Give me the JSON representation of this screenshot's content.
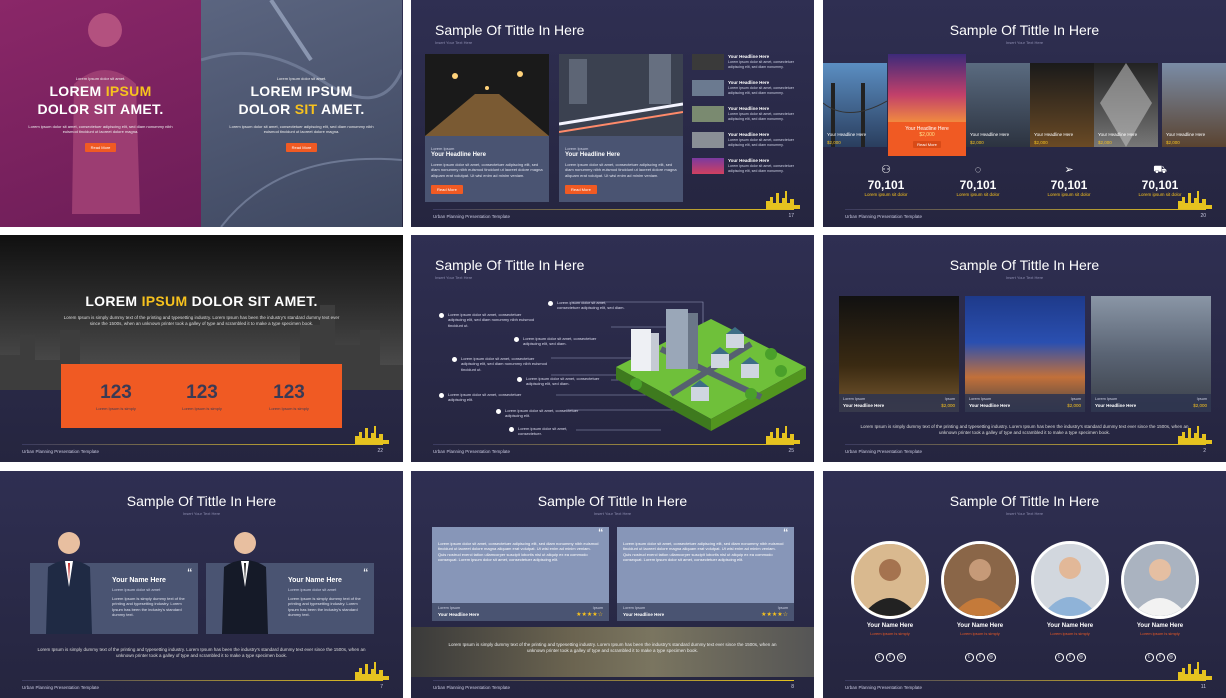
{
  "colors": {
    "accent": "#f05a23",
    "highlight": "#f7c21e",
    "slide_bg": "#2a2a48",
    "card": "#4a5472"
  },
  "common": {
    "footer": "Urban Planning Presentation Template",
    "title": "Sample Of Tittle In Here",
    "subtitle": "Insert Your Text Here",
    "read_more": "Read More",
    "lorem_short": "Lorem ipsum dolor sit amet, consectetuer adipiscing elit, sed diam nonummy nibh euismod tincidunt ut laoreet dolore magna aliquam erat volutpat. Ut wisi enim ad minim veniam.",
    "lorem_long": "Lorem Ipsum is simply dummy text of the printing and typesetting industry. Lorem Ipsum has been the industry's standard dummy text ever since the 1500s, when an unknown printer took a galley of type and scrambled it to make a type specimen book."
  },
  "slide1": {
    "left": {
      "kicker": "Lorem Ipsum dolor sit amet.",
      "line1_a": "LOREM ",
      "line1_b": "IPSUM",
      "line2": "DOLOR SIT AMET.",
      "body": "Lorem ipsum dolor sit amet, consectetuer adipiscing elit, sed diam nonummy nibh euismod tincidunt ut laoreet dolore magna."
    },
    "right": {
      "kicker": "Lorem Ipsum dolor sit amet.",
      "line1": "LOREM IPSUM",
      "line2_a": "DOLOR ",
      "line2_b": "SIT",
      "line2_c": " AMET.",
      "body": "Lorem ipsum dolor sit amet, consectetuer adipiscing elit, sed diam nonummy nibh euismod tincidunt ut laoreet dolore magna."
    }
  },
  "slide2": {
    "page": "17",
    "cards": [
      {
        "label": "Lorem Ipsum",
        "head": "Your Headline Here",
        "body": "Lorem ipsum dolor sit amet, consectetuer adipiscing elit, sed diam nonummy nibh euismod tincidunt ut laoreet dolore magna aliquam erat volutpat. Ut wisi enim ad minim veniam."
      },
      {
        "label": "Lorem Ipsum",
        "head": "Your Headline Here",
        "body": "Lorem ipsum dolor sit amet, consectetuer adipiscing elit, sed diam nonummy nibh euismod tincidunt ut laoreet dolore magna aliquam erat volutpat. Ut wisi enim ad minim veniam."
      }
    ],
    "list": [
      {
        "head": "Your Headline Here",
        "text": "Lorem ipsum dolor sit amet, consectetuer adipiscing elit, sed diam nonummy."
      },
      {
        "head": "Your Headline Here",
        "text": "Lorem ipsum dolor sit amet, consectetuer adipiscing elit, sed diam nonummy."
      },
      {
        "head": "Your Headline Here",
        "text": "Lorem ipsum dolor sit amet, consectetuer adipiscing elit, sed diam nonummy."
      },
      {
        "head": "Your Headline Here",
        "text": "Lorem ipsum dolor sit amet, consectetuer adipiscing elit, sed diam nonummy."
      },
      {
        "head": "Your Headline Here",
        "text": "Lorem ipsum dolor sit amet, consectetuer adipiscing elit, sed diam nonummy."
      }
    ]
  },
  "slide3": {
    "page": "20",
    "cells": [
      {
        "head": "Your Headline Here",
        "price": "$2,000"
      },
      {
        "head": "Your Headline Here",
        "price": "$2,000"
      },
      {
        "head": "Your Headline Here",
        "price": "$2,000"
      },
      {
        "head": "Your Headline Here",
        "price": "$2,000"
      },
      {
        "head": "Your Headline Here",
        "price": "$2,000"
      },
      {
        "head": "Your Headline Here",
        "price": "$2,000"
      }
    ],
    "stats": [
      {
        "icon": "user-icon",
        "num": "70,101",
        "label": "Lorem ipsum sit dolor"
      },
      {
        "icon": "chat-icon",
        "num": "70,101",
        "label": "Lorem ipsum sit dolor"
      },
      {
        "icon": "send-icon",
        "num": "70,101",
        "label": "Lorem ipsum sit dolor"
      },
      {
        "icon": "truck-icon",
        "num": "70,101",
        "label": "Lorem ipsum sit dolor"
      }
    ]
  },
  "slide4": {
    "page": "22",
    "t_a": "LOREM ",
    "t_b": "IPSUM",
    "t_c": " DOLOR SIT AMET.",
    "body": "Lorem Ipsum is simply dummy text of the printing and typesetting industry. Lorem Ipsum has been the industry's standard dummy text ever since the 1500s, when an unknown printer took a galley of type and scrambled it to make a type specimen book.",
    "counters": [
      {
        "num": "123",
        "label": "Lorem Ipsum is simply"
      },
      {
        "num": "123",
        "label": "Lorem Ipsum is simply"
      },
      {
        "num": "123",
        "label": "Lorem Ipsum is simply"
      }
    ]
  },
  "slide5": {
    "page": "25",
    "bullets": [
      "Lorem ipsum dolor sit amet, consectetuer adipiscing elit, sed diam.",
      "Lorem ipsum dolor sit amet, consectetuer adipiscing elit, sed diam nonummy nibh euismod tincidunt ut.",
      "Lorem ipsum dolor sit amet, consectetuer adipiscing elit, sed diam.",
      "Lorem ipsum dolor sit amet, consectetuer adipiscing elit, sed diam nonummy nibh euismod tincidunt ut.",
      "Lorem ipsum dolor sit amet, consectetuer adipiscing elit, sed diam.",
      "Lorem ipsum dolor sit amet, consectetuer adipiscing elit.",
      "Lorem ipsum dolor sit amet, consectetuer adipiscing elit.",
      "Lorem ipsum dolor sit amet, consectetuer."
    ]
  },
  "slide6": {
    "page": "2",
    "cards": [
      {
        "label": "Lorem Ipsum",
        "head": "Your Headline Here",
        "rlabel": "Ipsum",
        "price": "$2,000"
      },
      {
        "label": "Lorem Ipsum",
        "head": "Your Headline Here",
        "rlabel": "Ipsum",
        "price": "$2,000"
      },
      {
        "label": "Lorem Ipsum",
        "head": "Your Headline Here",
        "rlabel": "Ipsum",
        "price": "$2,000"
      }
    ],
    "body": "Lorem Ipsum is simply dummy text of the printing and typesetting industry. Lorem Ipsum has been the industry's standard dummy text ever since the 1500s, when an unknown printer took a galley of type and scrambled it to make a type specimen book."
  },
  "slide7": {
    "page": "7",
    "people": [
      {
        "name": "Your Name Here",
        "sub": "Lorem ipsum dolor sit amet",
        "text": "Lorem Ipsum is simply dummy text of the printing and typesetting industry. Lorem Ipsum has been the industry's standard dummy text."
      },
      {
        "name": "Your Name Here",
        "sub": "Lorem ipsum dolor sit amet",
        "text": "Lorem Ipsum is simply dummy text of the printing and typesetting industry. Lorem Ipsum has been the industry's standard dummy text."
      }
    ],
    "body": "Lorem Ipsum is simply dummy text of the printing and typesetting industry. Lorem Ipsum has been the industry's standard dummy text ever since the 1500s, when an unknown printer took a galley of type and scrambled it to make a type specimen book."
  },
  "slide8": {
    "page": "8",
    "quotes": [
      {
        "text": "Lorem ipsum dolor sit amet, consectetuer adipiscing elit, sed diam nonummy nibh euismod tincidunt ut laoreet dolore magna aliquam erat volutpat. Ut wisi enim ad minim veniam. Quis nostrud exerci tation ullamcorper suscipit lobortis nisl ut aliquip ex ea commodo consequat. Lorem ipsum dolor sit amet, consectetuer adipiscing elit.",
        "label": "Lorem Ipsum",
        "head": "Your Headline Here",
        "rlabel": "Ipsum",
        "stars": "★★★★☆"
      },
      {
        "text": "Lorem ipsum dolor sit amet, consectetuer adipiscing elit, sed diam nonummy nibh euismod tincidunt ut laoreet dolore magna aliquam erat volutpat. Ut wisi enim ad minim veniam. Quis nostrud exerci tation ullamcorper suscipit lobortis nisl ut aliquip ex ea commodo consequat. Lorem ipsum dolor sit amet, consectetuer adipiscing elit.",
        "label": "Lorem Ipsum",
        "head": "Your Headline Here",
        "rlabel": "Ipsum",
        "stars": "★★★★☆"
      }
    ],
    "body": "Lorem Ipsum is simply dummy text of the printing and typesetting industry. Lorem Ipsum has been the industry's standard dummy text ever since the 1500s, when an unknown printer took a galley of type and scrambled it to make a type specimen book."
  },
  "slide9": {
    "page": "11",
    "team": [
      {
        "name": "Your Name Here",
        "role": "Lorem ipsum is simply"
      },
      {
        "name": "Your Name Here",
        "role": "Lorem ipsum is simply"
      },
      {
        "name": "Your Name Here",
        "role": "Lorem ipsum is simply"
      },
      {
        "name": "Your Name Here",
        "role": "Lorem ipsum is simply"
      }
    ],
    "social": [
      "t",
      "f",
      "◎"
    ]
  }
}
